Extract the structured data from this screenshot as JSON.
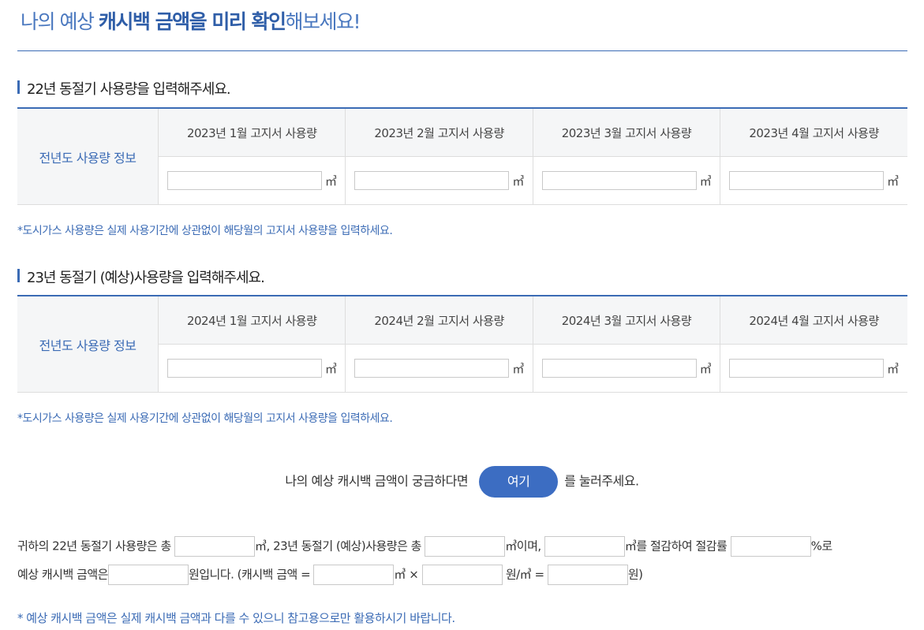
{
  "title": {
    "part1": "나의 예상 ",
    "highlight": "캐시백 금액을 미리 확인",
    "part2": "해보세요!"
  },
  "section1": {
    "heading": "22년 동절기 사용량을 입력해주세요.",
    "row_label": "전년도 사용량 정보",
    "columns": [
      "2023년 1월 고지서 사용량",
      "2023년 2월 고지서 사용량",
      "2023년 3월 고지서 사용량",
      "2023년 4월 고지서 사용량"
    ],
    "unit": "㎥",
    "note": "*도시가스 사용량은 실제 사용기간에 상관없이 해당월의 고지서 사용량을 입력하세요."
  },
  "section2": {
    "heading": "23년 동절기 (예상)사용량을 입력해주세요.",
    "row_label": "전년도 사용량 정보",
    "columns": [
      "2024년 1월 고지서 사용량",
      "2024년 2월 고지서 사용량",
      "2024년 3월 고지서 사용량",
      "2024년 4월 고지서 사용량"
    ],
    "unit": "㎥",
    "note": "*도시가스 사용량은 실제 사용기간에 상관없이 해당월의 고지서 사용량을 입력하세요."
  },
  "cta": {
    "before": "나의 예상 캐시백 금액이 궁금하다면",
    "button": "여기",
    "after": "를 눌러주세요."
  },
  "result": {
    "t1": "귀하의 22년 동절기 사용량은 총",
    "t2": "㎥, 23년 동절기 (예상)사용량은 총",
    "t3": "㎥이며,",
    "t4": "㎥를 절감하여 절감률",
    "t5": "%로",
    "t6": "예상 캐시백 금액은",
    "t7": "원입니다. (캐시백 금액 =",
    "t8": "㎥ ×",
    "t9": "원/㎥ =",
    "t10": "원)"
  },
  "footnote": "* 예상 캐시백 금액은 실제 캐시백 금액과 다를 수 있으니 참고용으로만 활용하시기 바랍니다."
}
